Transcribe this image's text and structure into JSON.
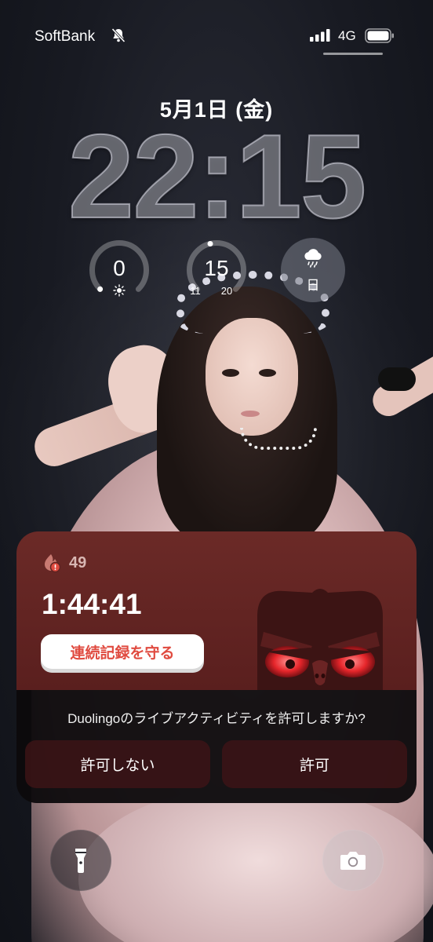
{
  "status_bar": {
    "carrier": "SoftBank",
    "network": "4G",
    "mute_icon": "bell-slash-icon",
    "signal_icon": "cellular-signal-icon",
    "battery_icon": "battery-icon"
  },
  "lock_screen": {
    "date": "5月1日 (金)",
    "time": "22:15"
  },
  "widgets": {
    "uv": {
      "value": "0",
      "icon": "sun-icon",
      "level": 0
    },
    "temperature": {
      "value": "15",
      "min": "11",
      "max": "20"
    },
    "weather": {
      "icon": "cloud-rain-icon",
      "label": "日"
    }
  },
  "live_activity": {
    "app_icon": "streak-flame-alert-icon",
    "streak_count": "49",
    "timer": "1:44:41",
    "cta_label": "連続記録を守る",
    "mascot_icon": "angry-owl-icon",
    "accent_color": "#e04b40",
    "background_color": "#5f2321"
  },
  "permission_prompt": {
    "message": "Duolingoのライブアクティビティを許可しますか?",
    "deny_label": "許可しない",
    "allow_label": "許可"
  },
  "bottom_controls": {
    "flashlight_icon": "flashlight-icon",
    "camera_icon": "camera-icon"
  }
}
